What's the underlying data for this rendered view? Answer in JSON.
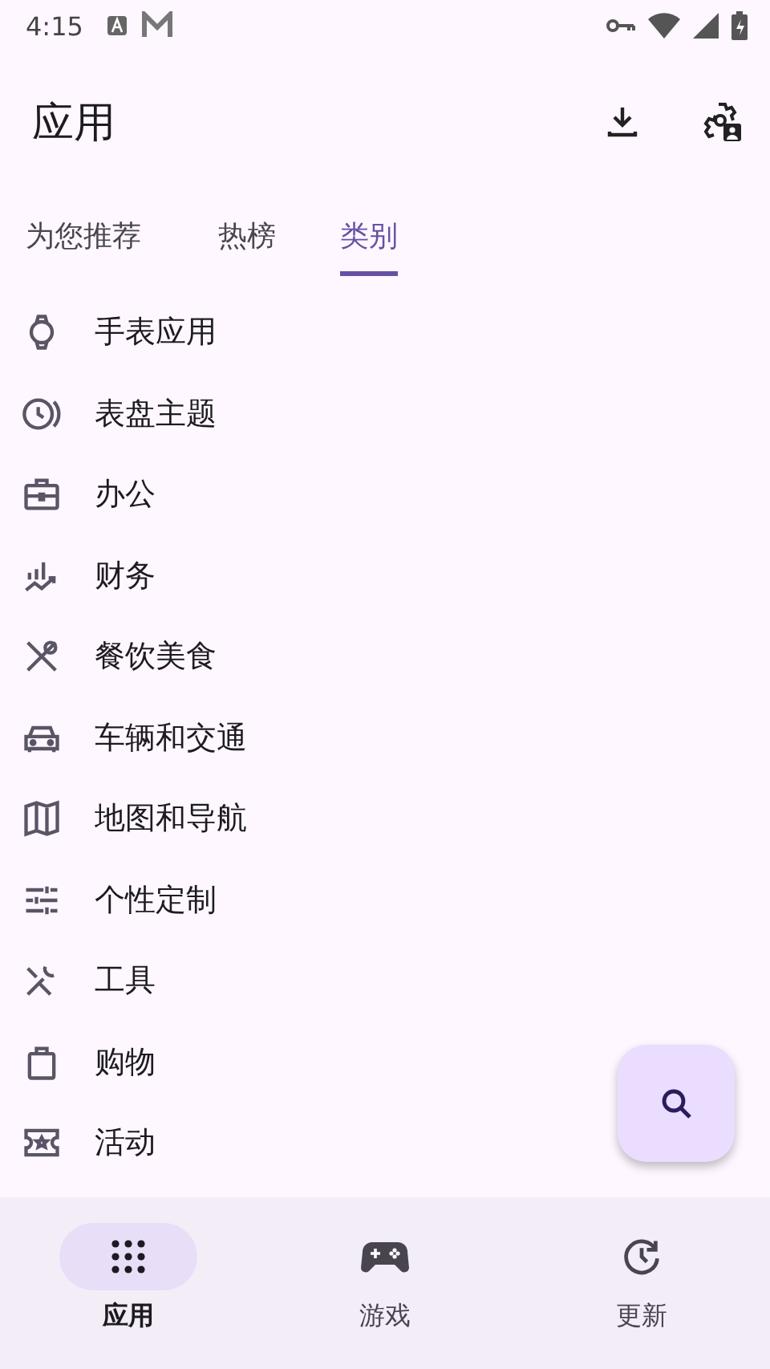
{
  "status_bar": {
    "time": "4:15"
  },
  "app_bar": {
    "title": "应用"
  },
  "tabs": [
    {
      "label": "为您推荐",
      "selected": false
    },
    {
      "label": "热榜",
      "selected": false
    },
    {
      "label": "类别",
      "selected": true
    }
  ],
  "categories": [
    {
      "label": "手表应用"
    },
    {
      "label": "表盘主题"
    },
    {
      "label": "办公"
    },
    {
      "label": "财务"
    },
    {
      "label": "餐饮美食"
    },
    {
      "label": "车辆和交通"
    },
    {
      "label": "地图和导航"
    },
    {
      "label": "个性定制"
    },
    {
      "label": "工具"
    },
    {
      "label": "购物"
    },
    {
      "label": "活动"
    }
  ],
  "bottom_nav": [
    {
      "label": "应用",
      "selected": true
    },
    {
      "label": "游戏",
      "selected": false
    },
    {
      "label": "更新",
      "selected": false
    }
  ]
}
